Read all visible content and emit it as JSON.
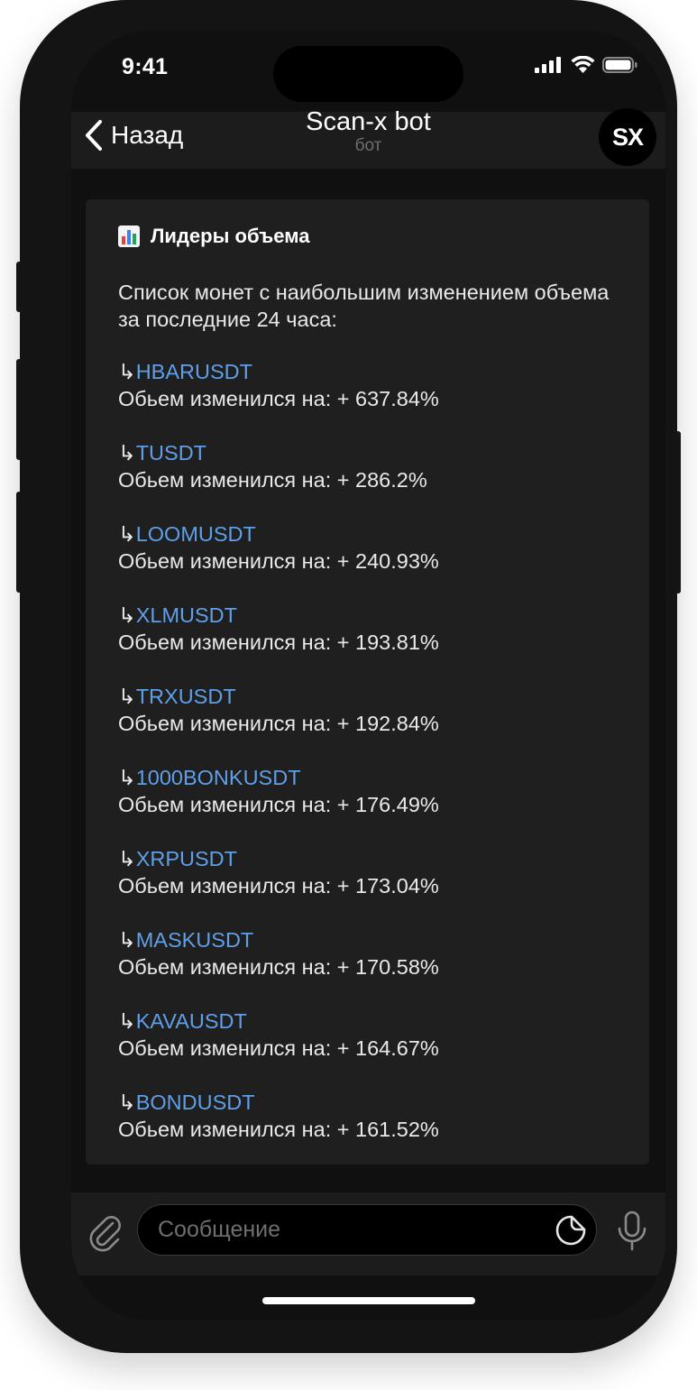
{
  "status_bar": {
    "time": "9:41"
  },
  "header": {
    "back_label": "Назад",
    "title": "Scan-x bot",
    "subtitle": "бот",
    "avatar_text": "SX"
  },
  "message": {
    "heading": "Лидеры объема",
    "intro": "Список монет с наибольшим изменением объема за последние 24 часа:",
    "arrow": "↳",
    "entries": [
      {
        "coin": "HBARUSDT",
        "change": "Обьем изменился на: + 637.84%"
      },
      {
        "coin": "TUSDT",
        "change": "Обьем изменился на: + 286.2%"
      },
      {
        "coin": "LOOMUSDT",
        "change": "Обьем изменился на: + 240.93%"
      },
      {
        "coin": "XLMUSDT",
        "change": "Обьем изменился на: + 193.81%"
      },
      {
        "coin": "TRXUSDT",
        "change": "Обьем изменился на: + 192.84%"
      },
      {
        "coin": "1000BONKUSDT",
        "change": "Обьем изменился на: + 176.49%"
      },
      {
        "coin": "XRPUSDT",
        "change": "Обьем изменился на: + 173.04%"
      },
      {
        "coin": "MASKUSDT",
        "change": "Обьем изменился на: + 170.58%"
      },
      {
        "coin": "KAVAUSDT",
        "change": "Обьем изменился на: + 164.67%"
      },
      {
        "coin": "BONDUSDT",
        "change": "Обьем изменился на: + 161.52%"
      }
    ]
  },
  "input": {
    "placeholder": "Сообщение"
  },
  "colors": {
    "link": "#5f9fe8",
    "background": "#101010",
    "bubble": "#1f1f1f"
  }
}
